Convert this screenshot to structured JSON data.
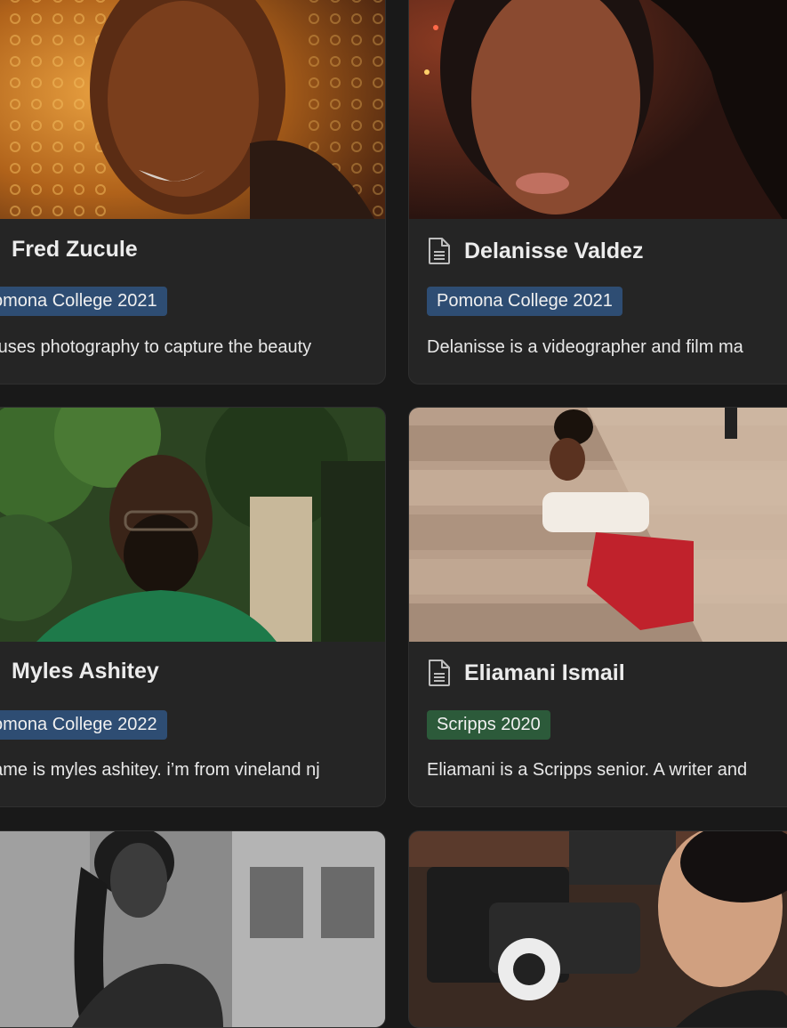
{
  "cards": [
    {
      "name": "Fred Zucule",
      "tag": "omona College 2021",
      "tag_color": "#2e4d73",
      "description": "d uses photography to capture the beauty"
    },
    {
      "name": "Delanisse Valdez",
      "icon": "page-icon",
      "tag": "Pomona College 2021",
      "tag_color": "#2e4d73",
      "description": "Delanisse is a videographer and film ma"
    },
    {
      "name": "Myles Ashitey",
      "tag": "omona College 2022",
      "tag_color": "#2e4d73",
      "description": "name is myles ashitey. i’m from vineland nj"
    },
    {
      "name": "Eliamani Ismail",
      "icon": "page-icon",
      "tag": "Scripps 2020",
      "tag_color": "#2c5a3a",
      "description": "Eliamani is a Scripps senior. A writer and"
    }
  ],
  "colors": {
    "background": "#191919",
    "card": "#252525",
    "text": "#ebebeb"
  }
}
